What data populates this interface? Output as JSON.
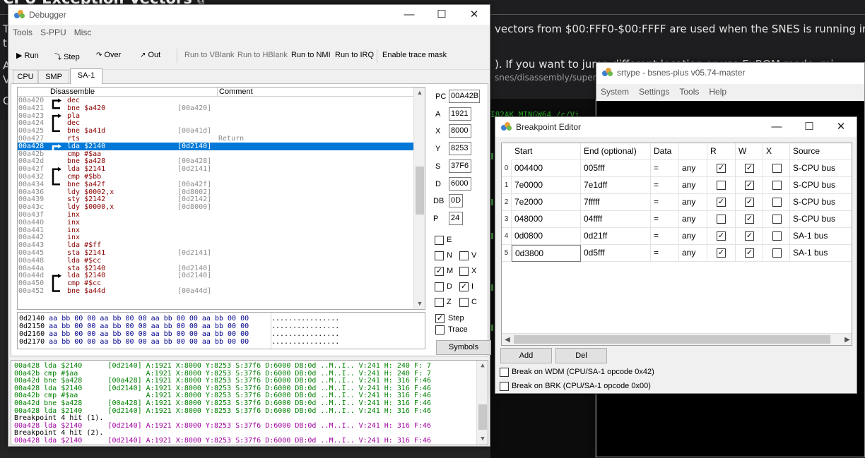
{
  "background_page": {
    "heading": "CPU Exception Vectors",
    "line1": "vectors from $00:FFF0-$00:FFFF are used when the SNES is running in em",
    "line2": "). If you want to jump     different location or use ExROM mode, mi",
    "path": "snes/disassembly/super r-ty",
    "left_chars": [
      "T",
      "t",
      "A",
      "V",
      "C"
    ],
    "terminal_line": "I82AK MINGW64 /c/Vi"
  },
  "debugger": {
    "title": "Debugger",
    "menu": [
      "Tools",
      "S-PPU",
      "Misc"
    ],
    "toolbar": {
      "run": "Run",
      "step": "Step",
      "over": "Over",
      "out": "Out",
      "run_vblank": "Run to VBlank",
      "run_hblank": "Run to HBlank",
      "run_nmi": "Run to NMI",
      "run_irq": "Run to IRQ",
      "trace_mask": "Enable trace mask"
    },
    "tabs": [
      "CPU",
      "SMP",
      "SA-1"
    ],
    "active_tab": "SA-1",
    "disasm_headers": {
      "disassemble": "Disassemble",
      "comment": "Comment"
    },
    "disasm": [
      {
        "addr": "00a420",
        "instr": "dec",
        "ref": "",
        "comment": ""
      },
      {
        "addr": "00a421",
        "instr": "bne $a420",
        "ref": "[00a420]",
        "comment": ""
      },
      {
        "addr": "00a423",
        "instr": "pla",
        "ref": "",
        "comment": ""
      },
      {
        "addr": "00a424",
        "instr": "dec",
        "ref": "",
        "comment": ""
      },
      {
        "addr": "00a425",
        "instr": "bne $a41d",
        "ref": "[00a41d]",
        "comment": ""
      },
      {
        "addr": "00a427",
        "instr": "rts",
        "ref": "",
        "comment": "Return"
      },
      {
        "addr": "00a428",
        "instr": "lda $2140",
        "ref": "[0d2140]",
        "comment": ""
      },
      {
        "addr": "00a42b",
        "instr": "cmp #$aa",
        "ref": "",
        "comment": ""
      },
      {
        "addr": "00a42d",
        "instr": "bne $a428",
        "ref": "[00a428]",
        "comment": ""
      },
      {
        "addr": "00a42f",
        "instr": "lda $2141",
        "ref": "[0d2141]",
        "comment": ""
      },
      {
        "addr": "00a432",
        "instr": "cmp #$bb",
        "ref": "",
        "comment": ""
      },
      {
        "addr": "00a434",
        "instr": "bne $a42f",
        "ref": "[00a42f]",
        "comment": ""
      },
      {
        "addr": "00a436",
        "instr": "ldy $0002,x",
        "ref": "[0d8002]",
        "comment": ""
      },
      {
        "addr": "00a439",
        "instr": "sty $2142",
        "ref": "[0d2142]",
        "comment": ""
      },
      {
        "addr": "00a43c",
        "instr": "ldy $0000,x",
        "ref": "[0d8000]",
        "comment": ""
      },
      {
        "addr": "00a43f",
        "instr": "inx",
        "ref": "",
        "comment": ""
      },
      {
        "addr": "00a440",
        "instr": "inx",
        "ref": "",
        "comment": ""
      },
      {
        "addr": "00a441",
        "instr": "inx",
        "ref": "",
        "comment": ""
      },
      {
        "addr": "00a442",
        "instr": "inx",
        "ref": "",
        "comment": ""
      },
      {
        "addr": "00a443",
        "instr": "lda #$ff",
        "ref": "",
        "comment": ""
      },
      {
        "addr": "00a445",
        "instr": "sta $2141",
        "ref": "[0d2141]",
        "comment": ""
      },
      {
        "addr": "00a448",
        "instr": "lda #$cc",
        "ref": "",
        "comment": ""
      },
      {
        "addr": "00a44a",
        "instr": "sta $2140",
        "ref": "[0d2140]",
        "comment": ""
      },
      {
        "addr": "00a44d",
        "instr": "lda $2140",
        "ref": "[0d2140]",
        "comment": ""
      },
      {
        "addr": "00a450",
        "instr": "cmp #$cc",
        "ref": "",
        "comment": ""
      },
      {
        "addr": "00a452",
        "instr": "bne $a44d",
        "ref": "[00a44d]",
        "comment": ""
      }
    ],
    "selected_row": 6,
    "registers": [
      {
        "name": "PC",
        "value": "00A42B"
      },
      {
        "name": "A",
        "value": "1921"
      },
      {
        "name": "X",
        "value": "8000"
      },
      {
        "name": "Y",
        "value": "8253"
      },
      {
        "name": "S",
        "value": "37F6"
      },
      {
        "name": "D",
        "value": "6000"
      },
      {
        "name": "DB",
        "value": "0D"
      },
      {
        "name": "P",
        "value": "24"
      }
    ],
    "flags": [
      {
        "name": "E",
        "checked": false
      },
      {
        "name": "N",
        "checked": false
      },
      {
        "name": "V",
        "checked": false
      },
      {
        "name": "M",
        "checked": true
      },
      {
        "name": "X",
        "checked": false
      },
      {
        "name": "D",
        "checked": false
      },
      {
        "name": "I",
        "checked": true
      },
      {
        "name": "Z",
        "checked": false
      },
      {
        "name": "C",
        "checked": false
      }
    ],
    "step_label": "Step",
    "step_checked": true,
    "trace_label": "Trace",
    "trace_checked": false,
    "symbols_label": "Symbols",
    "hex": [
      {
        "addr": "0d2140",
        "bytes": "aa bb 00 00 aa bb 00 00 aa bb 00 00 aa bb 00 00",
        "ascii": "................"
      },
      {
        "addr": "0d2150",
        "bytes": "aa bb 00 00 aa bb 00 00 aa bb 00 00 aa bb 00 00",
        "ascii": "................"
      },
      {
        "addr": "0d2160",
        "bytes": "aa bb 00 00 aa bb 00 00 aa bb 00 00 aa bb 00 00",
        "ascii": "................"
      },
      {
        "addr": "0d2170",
        "bytes": "aa bb 00 00 aa bb 00 00 aa bb 00 00 aa bb 00 00",
        "ascii": "................"
      }
    ],
    "console": [
      {
        "t": "00a428 lda $2140      [0d2140] A:1921 X:8000 Y:8253 S:37f6 D:6000 DB:0d ..M..I.. V:241 H: 240 F: 7",
        "k": "g"
      },
      {
        "t": "00a42b cmp #$aa                A:1921 X:8000 Y:8253 S:37f6 D:6000 DB:0d ..M..I.. V:241 H: 240 F: 7",
        "k": "g"
      },
      {
        "t": "00a42d bne $a428      [00a428] A:1921 X:8000 Y:8253 S:37f6 D:6000 DB:0d ..M..I.. V:241 H: 316 F:46",
        "k": "g"
      },
      {
        "t": "00a428 lda $2140      [0d2140] A:1921 X:8000 Y:8253 S:37f6 D:6000 DB:0d ..M..I.. V:241 H: 316 F:46",
        "k": "g"
      },
      {
        "t": "00a42b cmp #$aa                A:1921 X:8000 Y:8253 S:37f6 D:6000 DB:0d ..M..I.. V:241 H: 316 F:46",
        "k": "g"
      },
      {
        "t": "00a42d bne $a428      [00a428] A:1921 X:8000 Y:8253 S:37f6 D:6000 DB:0d ..M..I.. V:241 H: 316 F:46",
        "k": "g"
      },
      {
        "t": "00a428 lda $2140      [0d2140] A:1921 X:8000 Y:8253 S:37f6 D:6000 DB:0d ..M..I.. V:241 H: 316 F:46",
        "k": "g"
      },
      {
        "t": "Breakpoint 4 hit (1).",
        "k": "b"
      },
      {
        "t": "00a428 lda $2140      [0d2140] A:1921 X:8000 Y:8253 S:37f6 D:6000 DB:0d ..M..I.. V:241 H: 316 F:46",
        "k": "m"
      },
      {
        "t": "Breakpoint 4 hit (2).",
        "k": "b"
      },
      {
        "t": "00a428 lda $2140      [0d2140] A:1921 X:8000 Y:8253 S:37f6 D:6000 DB:0d ..M..I.. V:241 H: 316 F:46",
        "k": "m"
      }
    ]
  },
  "srtype": {
    "title": "srtype - bsnes-plus v05.74-master",
    "menu": [
      "System",
      "Settings",
      "Tools",
      "Help"
    ]
  },
  "breakpoint_editor": {
    "title": "Breakpoint Editor",
    "headers": {
      "start": "Start",
      "end": "End (optional)",
      "data": "Data",
      "cmp": "",
      "r": "R",
      "w": "W",
      "x": "X",
      "source": "Source"
    },
    "rows": [
      {
        "idx": "0",
        "start": "004400",
        "end": "005fff",
        "cmp": "=",
        "data": "any",
        "r": true,
        "w": true,
        "x": false,
        "source": "S-CPU bus"
      },
      {
        "idx": "1",
        "start": "7e0000",
        "end": "7e1dff",
        "cmp": "=",
        "data": "any",
        "r": false,
        "w": true,
        "x": false,
        "source": "S-CPU bus"
      },
      {
        "idx": "2",
        "start": "7e2000",
        "end": "7fffff",
        "cmp": "=",
        "data": "any",
        "r": true,
        "w": true,
        "x": false,
        "source": "S-CPU bus"
      },
      {
        "idx": "3",
        "start": "048000",
        "end": "04ffff",
        "cmp": "=",
        "data": "any",
        "r": false,
        "w": true,
        "x": false,
        "source": "S-CPU bus"
      },
      {
        "idx": "4",
        "start": "0d0800",
        "end": "0d21ff",
        "cmp": "=",
        "data": "any",
        "r": true,
        "w": true,
        "x": false,
        "source": "SA-1 bus"
      },
      {
        "idx": "5",
        "start": "0d3800",
        "end": "0d5fff",
        "cmp": "=",
        "data": "any",
        "r": true,
        "w": true,
        "x": false,
        "source": "SA-1 bus"
      }
    ],
    "add_label": "Add",
    "del_label": "Del",
    "break_wdm": "Break on WDM (CPU/SA-1 opcode 0x42)",
    "break_brk": "Break on BRK (CPU/SA-1 opcode 0x00)"
  },
  "colors": {
    "selection": "#0078d7",
    "console_green": "#008000",
    "console_magenta": "#a000a0",
    "disasm_red": "#8b0000"
  }
}
